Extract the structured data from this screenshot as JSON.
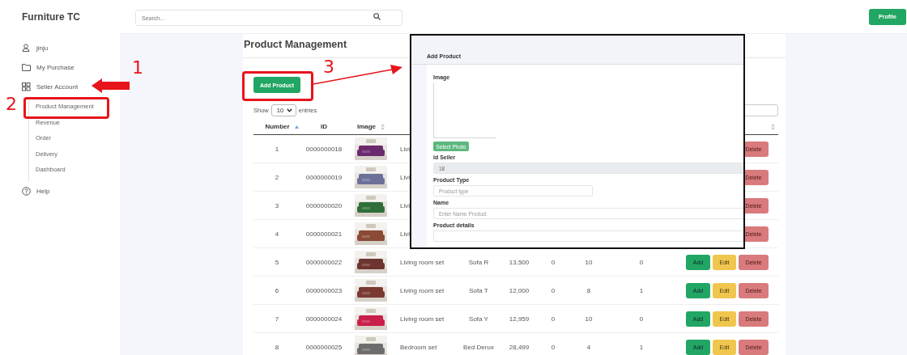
{
  "sidebar": {
    "brand": "Furniture TC",
    "items": [
      {
        "label": "jinju"
      },
      {
        "label": "My Purchase"
      },
      {
        "label": "Seller Account",
        "children": [
          {
            "label": "Product Management"
          },
          {
            "label": "Revenue"
          },
          {
            "label": "Order"
          },
          {
            "label": "Delivery"
          },
          {
            "label": "Dashboard"
          }
        ]
      },
      {
        "label": "Help"
      }
    ]
  },
  "topbar": {
    "search": {
      "placeholder": "Search..."
    },
    "profile_button": "Profile"
  },
  "page": {
    "title": "Product Management",
    "add_button": "Add Product",
    "length": {
      "before": "Show",
      "value": "10",
      "after": "entries"
    },
    "table": {
      "columns": [
        {
          "label": "Number",
          "sortable": true,
          "sorted": true
        },
        {
          "label": "ID",
          "sortable": false
        },
        {
          "label": "Image",
          "sortable": true,
          "sorted": false
        },
        {},
        {},
        {},
        {},
        {},
        {},
        {
          "sortable": true,
          "sorted": false
        }
      ],
      "rows": [
        {
          "cells": [
            "1",
            "0000000018",
            "",
            "Livi"
          ],
          "actions": [
            {
              "kind": "delete",
              "label": "Delete"
            }
          ]
        },
        {
          "cells": [
            "2",
            "0000000019",
            "",
            "Livi"
          ],
          "actions": [
            {
              "kind": "delete",
              "label": "Delete"
            }
          ]
        },
        {
          "cells": [
            "3",
            "0000000020",
            "",
            "Livi"
          ],
          "actions": [
            {
              "kind": "delete",
              "label": "Delete"
            }
          ]
        },
        {
          "cells": [
            "4",
            "0000000021",
            "",
            "Livi"
          ],
          "actions": [
            {
              "kind": "delete",
              "label": "Delete"
            }
          ]
        },
        {
          "cells": [
            "5",
            "0000000022",
            "",
            "Living room set",
            "Sofa R",
            "13,500",
            "0",
            "10",
            "0"
          ],
          "actions": [
            {
              "kind": "add",
              "label": "Add"
            },
            {
              "kind": "edit",
              "label": "Edit"
            },
            {
              "kind": "delete",
              "label": "Delete"
            }
          ]
        },
        {
          "cells": [
            "6",
            "0000000023",
            "",
            "Living room set",
            "Sofa T",
            "12,000",
            "0",
            "8",
            "1"
          ],
          "actions": [
            {
              "kind": "add",
              "label": "Add"
            },
            {
              "kind": "edit",
              "label": "Edit"
            },
            {
              "kind": "delete",
              "label": "Delete"
            }
          ]
        },
        {
          "cells": [
            "7",
            "0000000024",
            "",
            "Living room set",
            "Sofa Y",
            "12,959",
            "0",
            "10",
            "0"
          ],
          "actions": [
            {
              "kind": "add",
              "label": "Add"
            },
            {
              "kind": "edit",
              "label": "Edit"
            },
            {
              "kind": "delete",
              "label": "Delete"
            }
          ]
        },
        {
          "cells": [
            "8",
            "0000000025",
            "",
            "Bedroom set",
            "Bed Derux",
            "28,499",
            "0",
            "4",
            "1"
          ],
          "actions": [
            {
              "kind": "add",
              "label": "Add"
            },
            {
              "kind": "edit",
              "label": "Edit"
            },
            {
              "kind": "delete",
              "label": "Delete"
            }
          ]
        }
      ]
    }
  },
  "inset": {
    "title": "Add Product",
    "image_label": "Image",
    "select_button": "Select Photo",
    "fields": [
      {
        "label": "Id Seller",
        "value": "18",
        "disabled": true,
        "kind": "wide"
      },
      {
        "label": "Product Type",
        "placeholder": "Product type",
        "disabled": false,
        "kind": "short"
      },
      {
        "label": "Name",
        "placeholder": "Enter Name Product",
        "disabled": false,
        "kind": "wide"
      },
      {
        "label": "Product details",
        "disabled": false,
        "kind": "wide"
      }
    ]
  },
  "annotations": {
    "labels": [
      "1",
      "2",
      "3"
    ]
  }
}
